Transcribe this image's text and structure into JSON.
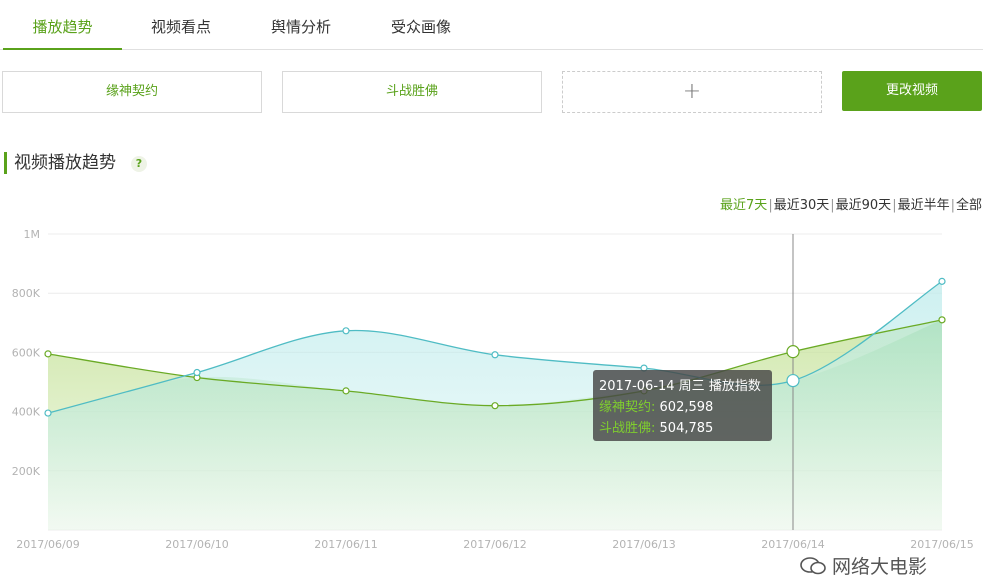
{
  "tabs": [
    {
      "label": "播放趋势",
      "active": true
    },
    {
      "label": "视频看点",
      "active": false
    },
    {
      "label": "舆情分析",
      "active": false
    },
    {
      "label": "受众画像",
      "active": false
    }
  ],
  "compare": {
    "slot1": "缘神契约",
    "slot2": "斗战胜佛",
    "add_symbol": "+",
    "change_button": "更改视频"
  },
  "section": {
    "title": "视频播放趋势",
    "help": "?"
  },
  "ranges": [
    "最近7天",
    "最近30天",
    "最近90天",
    "最近半年",
    "全部"
  ],
  "tooltip": {
    "header": "2017-06-14 周三 播放指数",
    "series_a_label": "缘神契约:",
    "series_a_value": "602,598",
    "series_b_label": "斗战胜佛:",
    "series_b_value": "504,785"
  },
  "watermark": "网络大电影",
  "colors": {
    "accent": "#5aa21b",
    "series_green": "#6aaa25",
    "series_teal": "#4fbcc4"
  },
  "chart_data": {
    "type": "area",
    "x": [
      "2017/06/09",
      "2017/06/10",
      "2017/06/11",
      "2017/06/12",
      "2017/06/13",
      "2017/06/14",
      "2017/06/15"
    ],
    "series": [
      {
        "name": "缘神契约",
        "values": [
          595000,
          515000,
          470000,
          420000,
          470000,
          602598,
          710000
        ]
      },
      {
        "name": "斗战胜佛",
        "values": [
          395000,
          532000,
          673000,
          592000,
          547000,
          504785,
          840000
        ]
      }
    ],
    "yticks": [
      "",
      "200K",
      "400K",
      "600K",
      "800K",
      "1M"
    ],
    "ylim": [
      0,
      1000000
    ],
    "grid": true,
    "highlight_index": 5
  }
}
